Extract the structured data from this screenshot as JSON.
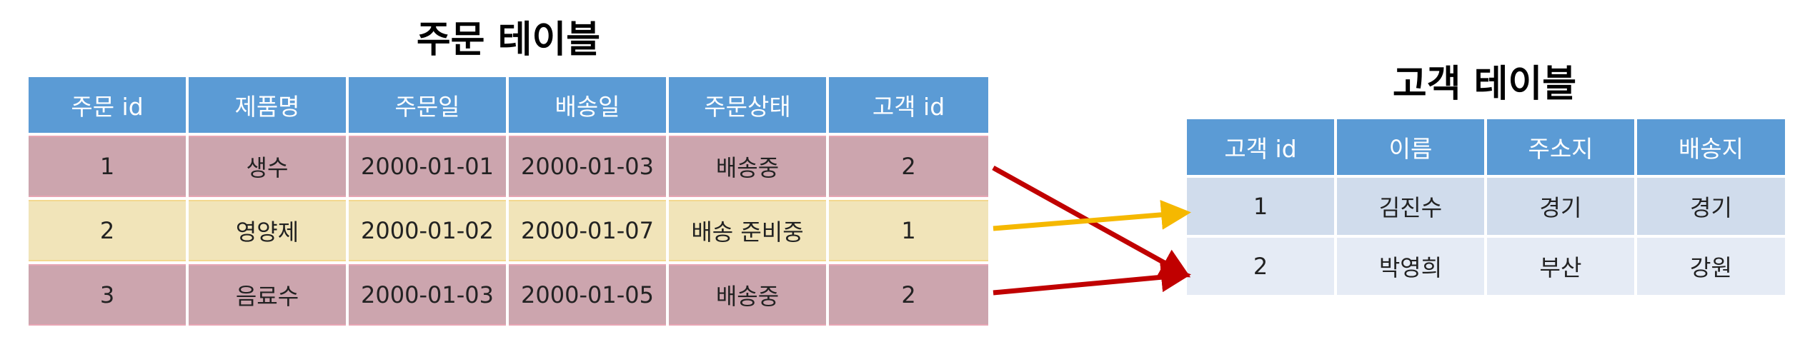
{
  "orders": {
    "title": "주문 테이블",
    "headers": [
      "주문 id",
      "제품명",
      "주문일",
      "배송일",
      "주문상태",
      "고객 id"
    ],
    "rows": [
      [
        "1",
        "생수",
        "2000-01-01",
        "2000-01-03",
        "배송중",
        "2"
      ],
      [
        "2",
        "영양제",
        "2000-01-02",
        "2000-01-07",
        "배송 준비중",
        "1"
      ],
      [
        "3",
        "음료수",
        "2000-01-03",
        "2000-01-05",
        "배송중",
        "2"
      ]
    ]
  },
  "customers": {
    "title": "고객 테이블",
    "headers": [
      "고객 id",
      "이름",
      "주소지",
      "배송지"
    ],
    "rows": [
      [
        "1",
        "김진수",
        "경기",
        "경기"
      ],
      [
        "2",
        "박영희",
        "부산",
        "강원"
      ]
    ]
  },
  "colors": {
    "header": "#5b9bd5",
    "row_shipping": "#cca5ae",
    "row_preparing": "#f1e4b9",
    "customer_row_1": "#d0dcec",
    "customer_row_2": "#e5ebf5",
    "arrow_red": "#c00000",
    "arrow_yellow": "#f5b800"
  },
  "arrows": [
    {
      "from_order_row": 1,
      "to_customer_row": 2,
      "color": "red"
    },
    {
      "from_order_row": 2,
      "to_customer_row": 1,
      "color": "yellow"
    },
    {
      "from_order_row": 3,
      "to_customer_row": 2,
      "color": "red"
    }
  ]
}
